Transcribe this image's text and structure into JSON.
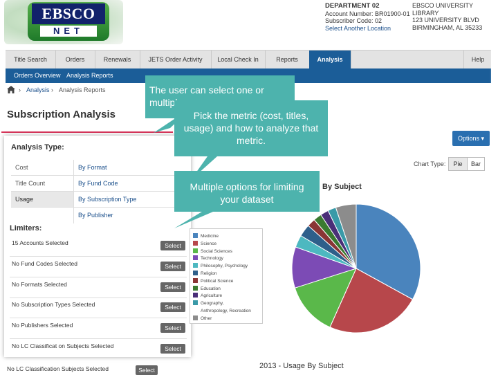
{
  "logo": {
    "top": "EBSCO",
    "bottom": "NET"
  },
  "account": {
    "dept": "DEPARTMENT 02",
    "number": "Account Number: BR01900-01",
    "subscriber": "Subscriber Code: 02",
    "select_location": "Select Another Location",
    "lib_name": "EBSCO UNIVERSITY LIBRARY",
    "lib_street": "123 UNIVERSITY BLVD",
    "lib_city": "BIRMINGHAM, AL 35233"
  },
  "nav": {
    "tabs": [
      "Title Search",
      "Orders",
      "Renewals",
      "JETS Order Activity",
      "Local Check In",
      "Reports",
      "Analysis"
    ],
    "help": "Help",
    "sub": [
      "Orders Overview",
      "Analysis Reports"
    ]
  },
  "breadcrumb": [
    "Analysis",
    "Analysis Reports"
  ],
  "page_title": "Subscription Analysis",
  "options_label": "Options ▾",
  "chart_type": {
    "label": "Chart Type:",
    "pie": "Pie",
    "bar": "Bar"
  },
  "analysis_type": {
    "heading": "Analysis Type:",
    "metrics": [
      "Cost",
      "Title Count",
      "Usage"
    ],
    "methods": [
      "By Format",
      "By Fund Code",
      "By Subscription Type",
      "By Publisher"
    ]
  },
  "limiters": {
    "heading": "Limiters:",
    "rows": [
      "15 Accounts Selected",
      "No Fund Codes Selected",
      "No Formats Selected",
      "No Subscription Types Selected",
      "No Publishers Selected",
      "No LC Classificat on Subjects Selected"
    ],
    "select_label": "Select",
    "below_row": "No LC Classification Subjects Selected"
  },
  "callouts": {
    "years": "The user can select one or multiple years.",
    "metric": "Pick the metric (cost, titles, usage) and how to analyze that metric.",
    "limits": "Multiple options for limiting your dataset"
  },
  "chart_title_tail": "By Subject",
  "chart2_title": "2013 - Usage By Subject",
  "chart_data": {
    "type": "pie",
    "title": "By Subject",
    "categories": [
      "Medicine",
      "Science",
      "Social Sciences",
      "Technology",
      "Philosophy, Psychology",
      "Religion",
      "Political Science",
      "Education",
      "Agriculture",
      "Geography, Anthropology, Recreation",
      "Other"
    ],
    "values": [
      32,
      23,
      13,
      10,
      3,
      3,
      2,
      2,
      2,
      2,
      5
    ],
    "colors": [
      "#4a84bd",
      "#b7474b",
      "#5ab84a",
      "#7c4bb5",
      "#4db8c0",
      "#2e5f8a",
      "#8a3535",
      "#3a7a30",
      "#4a2f78",
      "#3a9aa8",
      "#8c8c8c"
    ],
    "legend_position": "left"
  }
}
